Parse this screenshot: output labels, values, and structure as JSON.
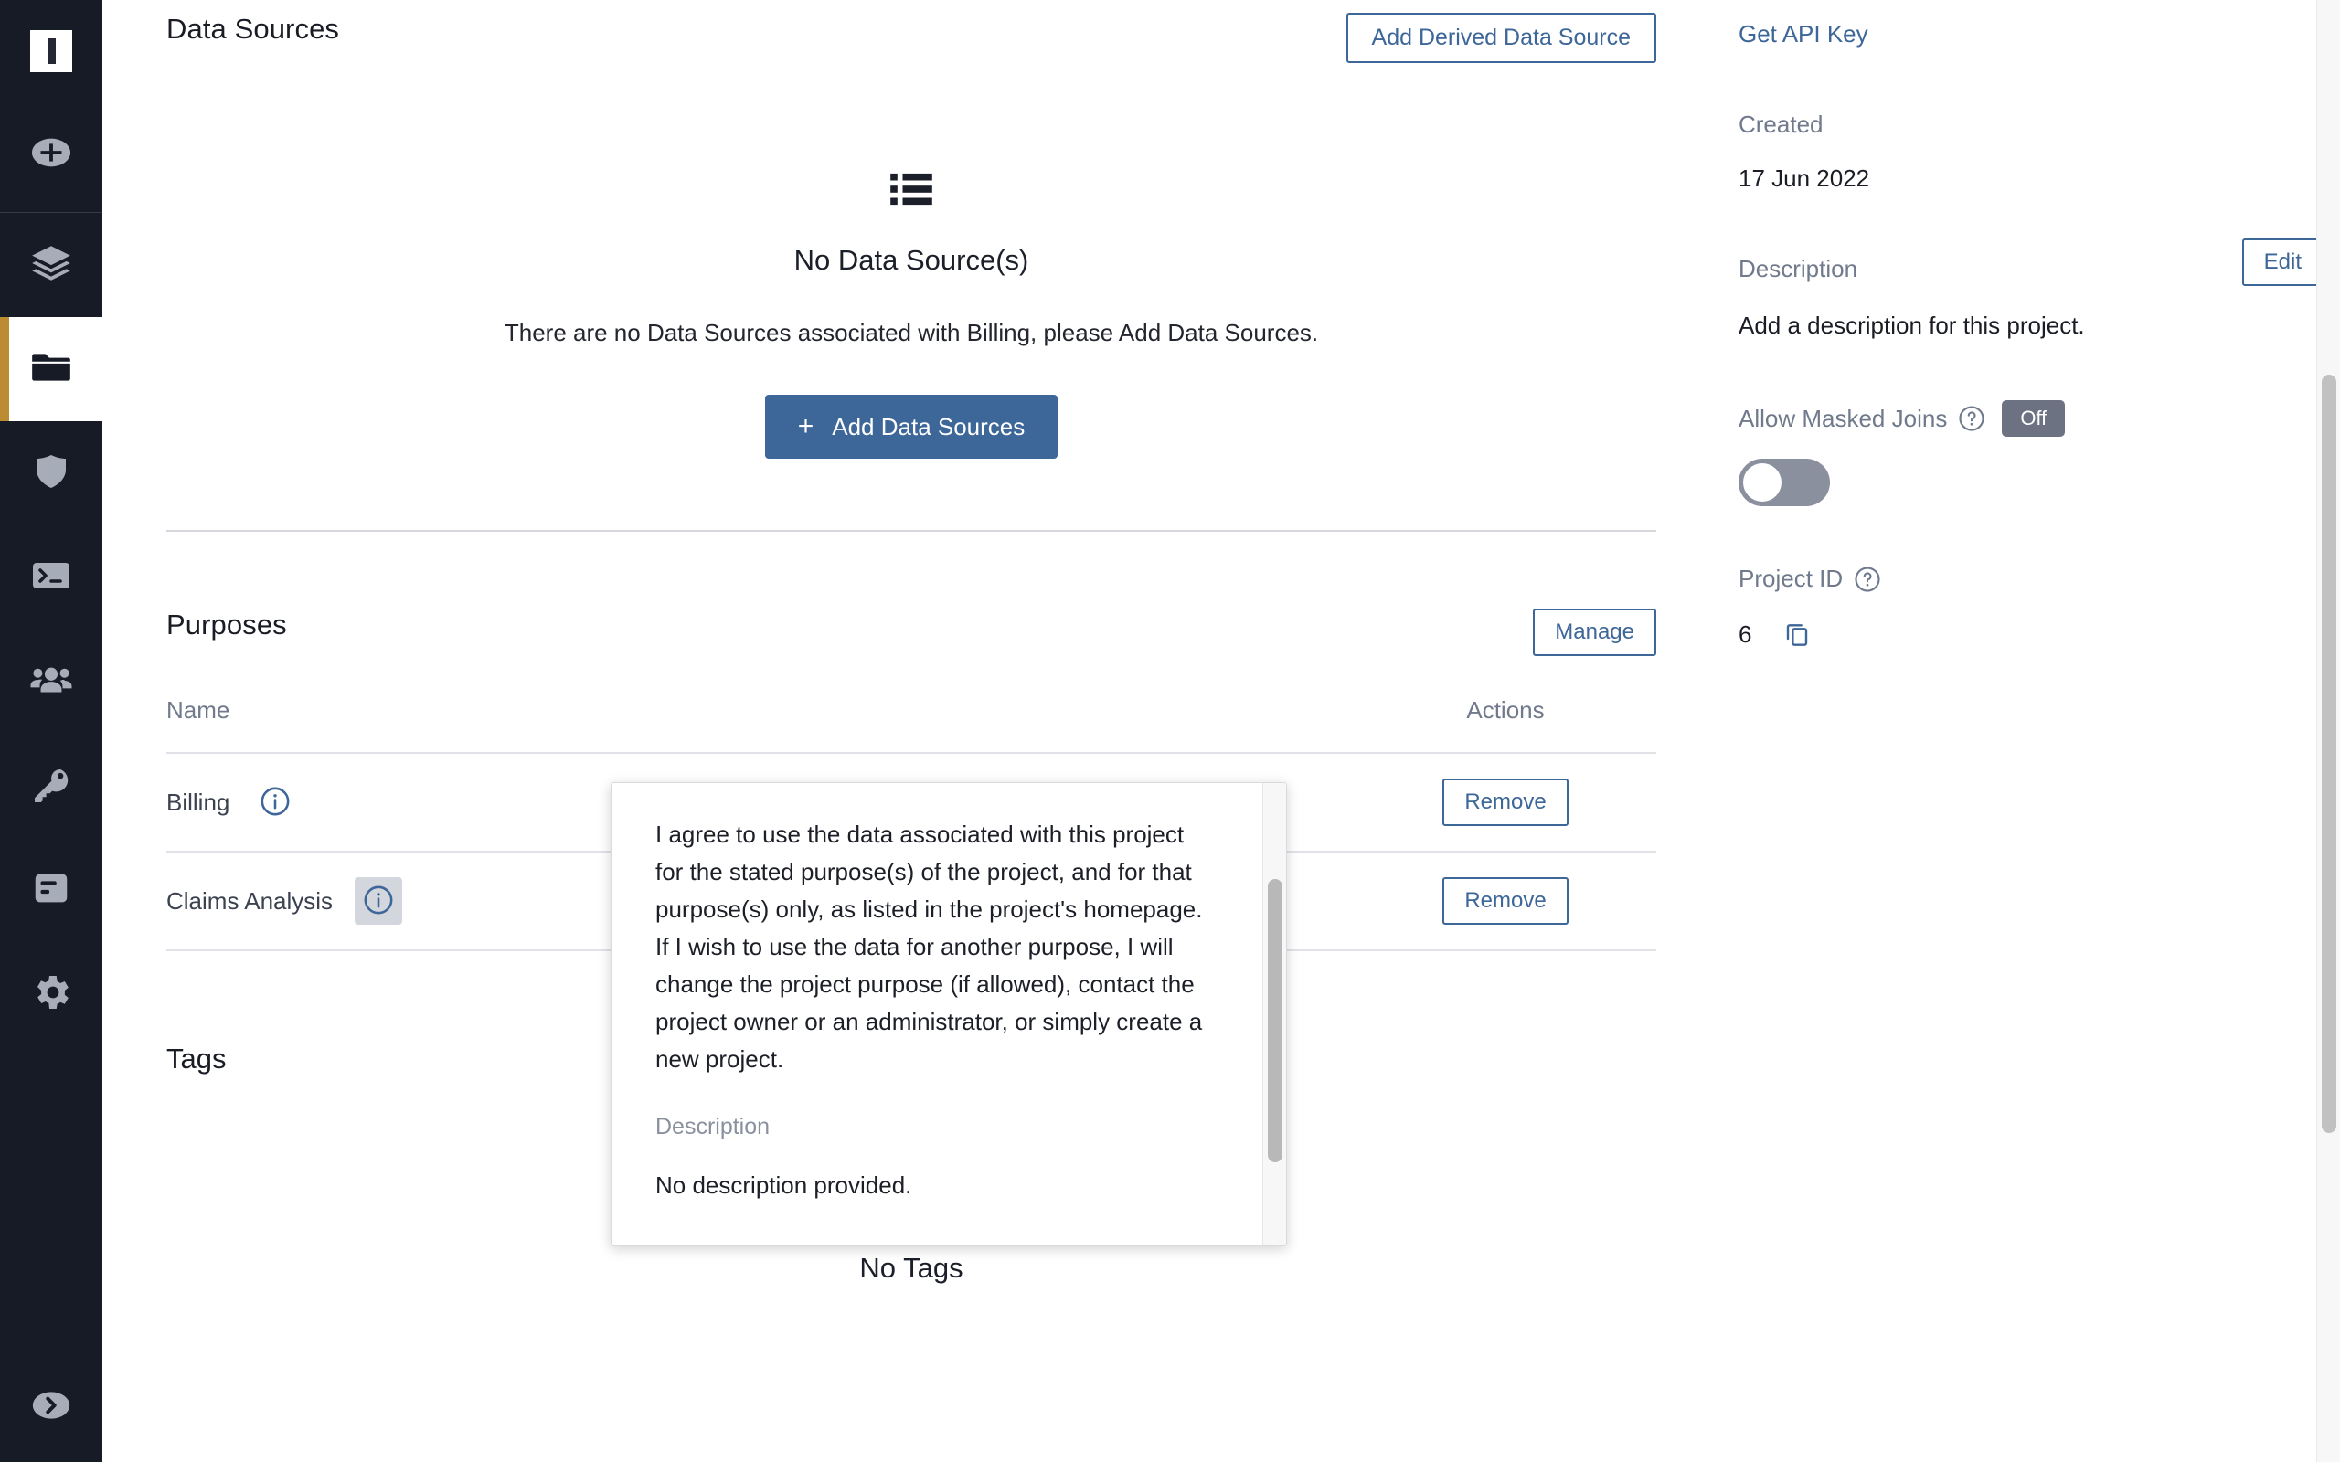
{
  "sidebar": {
    "logo_name": "app-logo",
    "items": [
      {
        "id": "add",
        "icon": "plus-circle-icon",
        "active": false
      },
      {
        "id": "layers",
        "icon": "layers-icon",
        "active": false
      },
      {
        "id": "projects",
        "icon": "folder-icon",
        "active": true
      },
      {
        "id": "policies",
        "icon": "shield-icon",
        "active": false
      },
      {
        "id": "terminal",
        "icon": "terminal-icon",
        "active": false
      },
      {
        "id": "users",
        "icon": "users-icon",
        "active": false
      },
      {
        "id": "keys",
        "icon": "key-icon",
        "active": false
      },
      {
        "id": "reports",
        "icon": "report-icon",
        "active": false
      },
      {
        "id": "settings",
        "icon": "gear-icon",
        "active": false
      }
    ],
    "bottom": {
      "id": "expand",
      "icon": "arrow-right-circle-icon"
    }
  },
  "data_sources": {
    "title": "Data Sources",
    "add_derived_label": "Add Derived Data Source",
    "empty": {
      "icon": "list-icon",
      "title": "No Data Source(s)",
      "subtitle": "There are no Data Sources associated with Billing, please Add Data Sources.",
      "button_label": "Add Data Sources",
      "button_plus": "+"
    }
  },
  "purposes": {
    "title": "Purposes",
    "manage_label": "Manage",
    "columns": {
      "name": "Name",
      "actions": "Actions"
    },
    "rows": [
      {
        "name": "Billing",
        "info_icon": "info-icon",
        "info_hover": false,
        "action_label": "Remove"
      },
      {
        "name": "Claims Analysis",
        "info_icon": "info-icon",
        "info_hover": true,
        "action_label": "Remove"
      }
    ]
  },
  "tags": {
    "title": "Tags",
    "empty": {
      "icon": "list-icon",
      "title": "No Tags"
    }
  },
  "details": {
    "api_key_label": "Get API Key",
    "created_label": "Created",
    "created_value": "17 Jun 2022",
    "description_label": "Description",
    "edit_label": "Edit",
    "description_value": "Add a description for this project.",
    "masked_joins_label": "Allow Masked Joins",
    "masked_joins_state": "Off",
    "masked_joins_help": "help-icon",
    "project_id_label": "Project ID",
    "project_id_help": "help-icon",
    "project_id_value": "6",
    "copy_icon": "copy-icon"
  },
  "tooltip": {
    "body": "I agree to use the data associated with this project for the stated purpose(s) of the project, and for that purpose(s) only, as listed in the project's homepage. If I wish to use the data for another purpose, I will change the project purpose (if allowed), contact the project owner or an administrator, or simply create a new project.",
    "description_label": "Description",
    "description_value": "No description provided."
  },
  "colors": {
    "rail_bg": "#171b26",
    "accent_gold": "#bc8c33",
    "primary_blue": "#3d6699",
    "muted_text": "#707a8c",
    "toggle_off": "#8b909e",
    "pill_off": "#6d7283"
  }
}
